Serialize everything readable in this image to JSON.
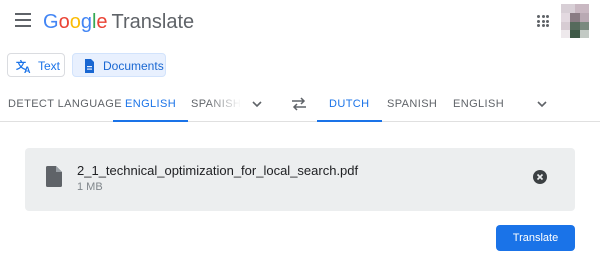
{
  "header": {
    "logo_google": [
      "G",
      "o",
      "o",
      "g",
      "l",
      "e"
    ],
    "logo_colors": [
      "#4285f4",
      "#ea4335",
      "#fbbc05",
      "#4285f4",
      "#34a853",
      "#ea4335"
    ],
    "product": "Translate",
    "menu_icon": "hamburger-menu-icon",
    "apps_icon": "apps-grid-icon"
  },
  "modes": {
    "text_label": "Text",
    "documents_label": "Documents",
    "selected": "Documents"
  },
  "source_languages": {
    "detect": "DETECT LANGUAGE",
    "english": "ENGLISH",
    "spanish": "SPANISH",
    "selected": "ENGLISH"
  },
  "target_languages": {
    "dutch": "DUTCH",
    "spanish": "SPANISH",
    "english": "ENGLISH",
    "selected": "DUTCH"
  },
  "file": {
    "name": "2_1_technical_optimization_for_local_search.pdf",
    "size": "1 MB"
  },
  "actions": {
    "translate_label": "Translate"
  },
  "colors": {
    "accent": "#1a73e8",
    "file_card_bg": "#eceeef"
  }
}
